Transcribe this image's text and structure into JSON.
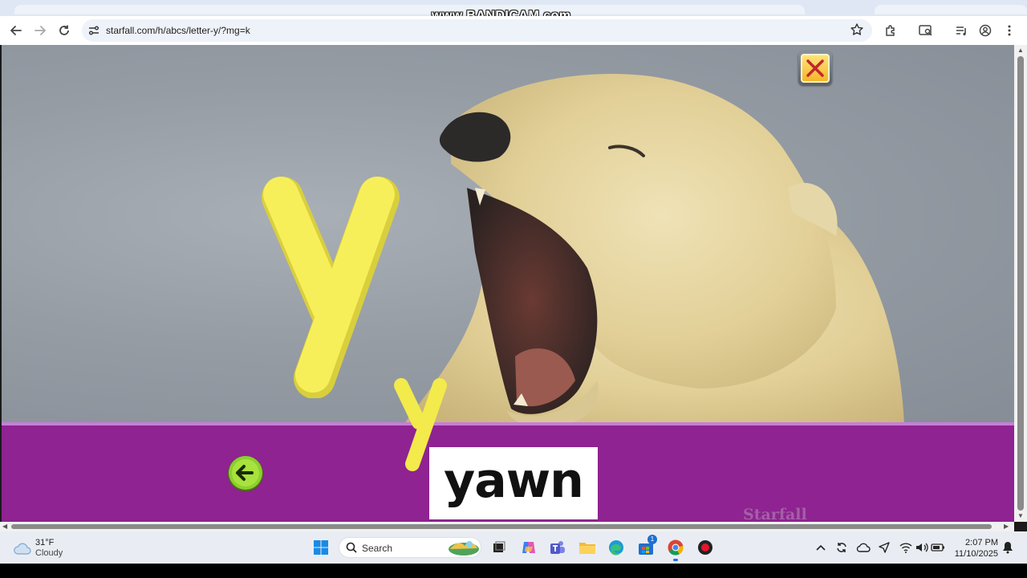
{
  "watermark": "www.BANDICAM.com",
  "browser": {
    "url": "starfall.com/h/abcs/letter-y/?mg=k",
    "icons": [
      "back-icon",
      "forward-icon",
      "reload-icon",
      "site-settings-icon",
      "bookmark-star-icon",
      "extensions-icon",
      "tab-search-icon",
      "reading-list-icon",
      "profile-icon",
      "menu-icon"
    ]
  },
  "lesson": {
    "word": "yawn",
    "logo": "Starfall",
    "colors": {
      "band": "#8e2391",
      "letter": "#f7ef5a"
    }
  },
  "taskbar": {
    "weather": {
      "temp": "31°F",
      "condition": "Cloudy"
    },
    "search_label": "Search",
    "time": "2:07 PM",
    "date": "11/10/2025",
    "store_badge": "1"
  }
}
